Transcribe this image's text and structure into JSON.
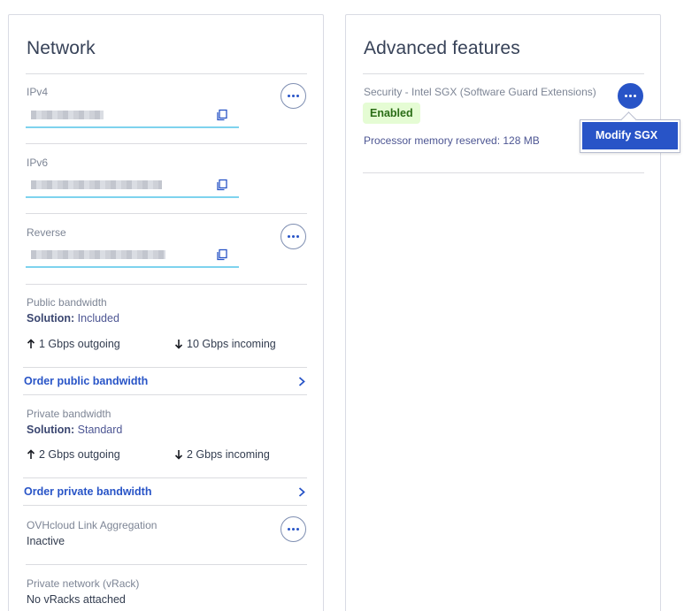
{
  "network": {
    "title": "Network",
    "ipv4": {
      "label": "IPv4"
    },
    "ipv6": {
      "label": "IPv6"
    },
    "reverse": {
      "label": "Reverse"
    },
    "public_bandwidth": {
      "label": "Public bandwidth",
      "solution_key": "Solution:",
      "solution_value": "Included",
      "outgoing": "1 Gbps outgoing",
      "incoming": "10 Gbps incoming",
      "order_link": "Order public bandwidth"
    },
    "private_bandwidth": {
      "label": "Private bandwidth",
      "solution_key": "Solution:",
      "solution_value": "Standard",
      "outgoing": "2 Gbps outgoing",
      "incoming": "2 Gbps incoming",
      "order_link": "Order private bandwidth"
    },
    "link_aggregation": {
      "label": "OVHcloud Link Aggregation",
      "value": "Inactive"
    },
    "vrack": {
      "label": "Private network (vRack)",
      "value": "No vRacks attached"
    }
  },
  "advanced": {
    "title": "Advanced features",
    "sgx": {
      "label": "Security - Intel SGX (Software Guard Extensions)",
      "status": "Enabled",
      "memory": "Processor memory reserved: 128 MB"
    },
    "menu": {
      "modify_sgx": "Modify SGX"
    }
  },
  "colors": {
    "accent": "#2854c7",
    "badge_bg": "#e5fcd4",
    "badge_text": "#2a6c16",
    "field_underline": "#7ed3ee"
  },
  "icons": {
    "copy": "copy-icon",
    "more": "ellipsis-icon",
    "up": "arrow-up-icon",
    "down": "arrow-down-icon",
    "chevron": "chevron-right-icon"
  }
}
